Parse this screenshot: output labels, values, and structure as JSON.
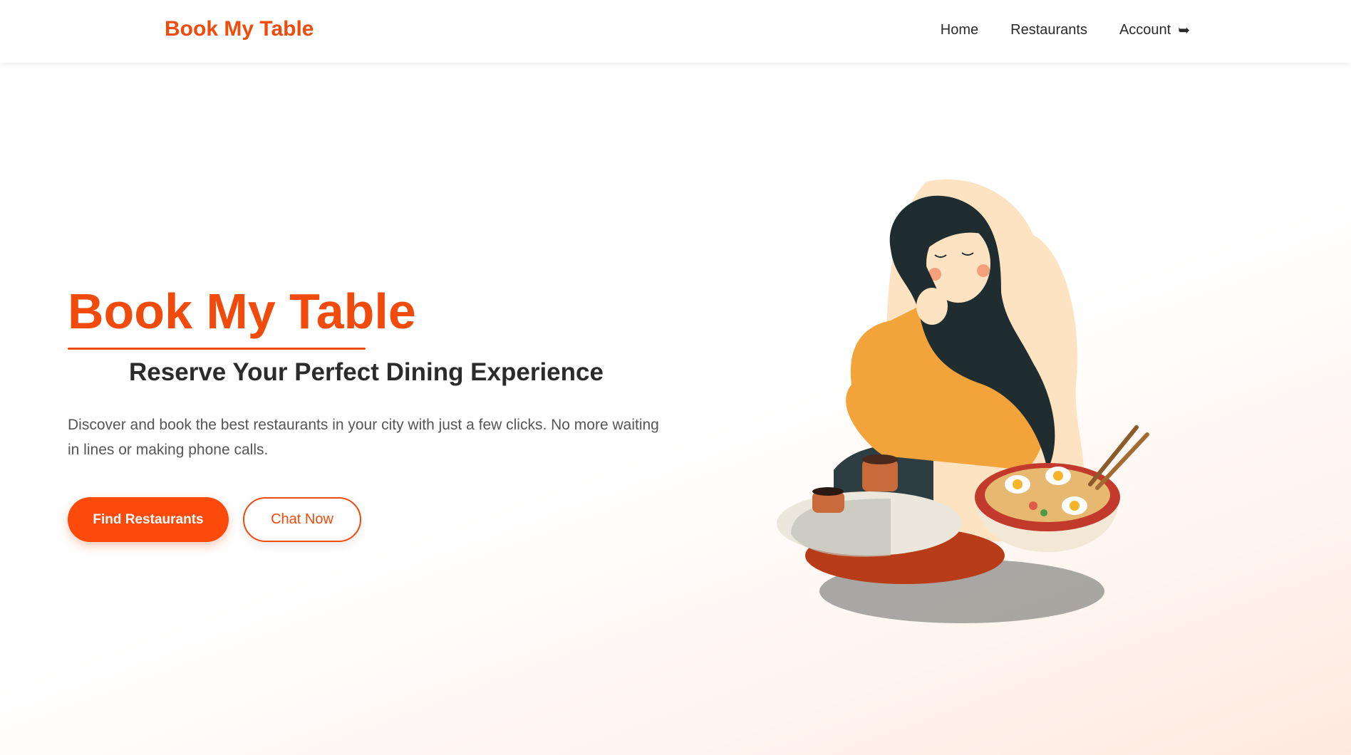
{
  "navbar": {
    "brand": "Book My Table",
    "links": [
      {
        "label": "Home"
      },
      {
        "label": "Restaurants"
      },
      {
        "label": "Account",
        "icon": "logout-arrow-icon"
      }
    ]
  },
  "hero": {
    "title": "Book My Table",
    "subtitle": "Reserve Your Perfect Dining Experience",
    "description": "Discover and book the best restaurants in your city with just a few clicks. No more waiting in lines or making phone calls.",
    "primary_button": "Find Restaurants",
    "secondary_button": "Chat Now",
    "illustration": "woman-eating-noodles-illustration"
  },
  "colors": {
    "brand": "#f04a0c",
    "primary_button": "#fc4a0b",
    "text_dark": "#2b2b2b",
    "text_muted": "#555555"
  }
}
